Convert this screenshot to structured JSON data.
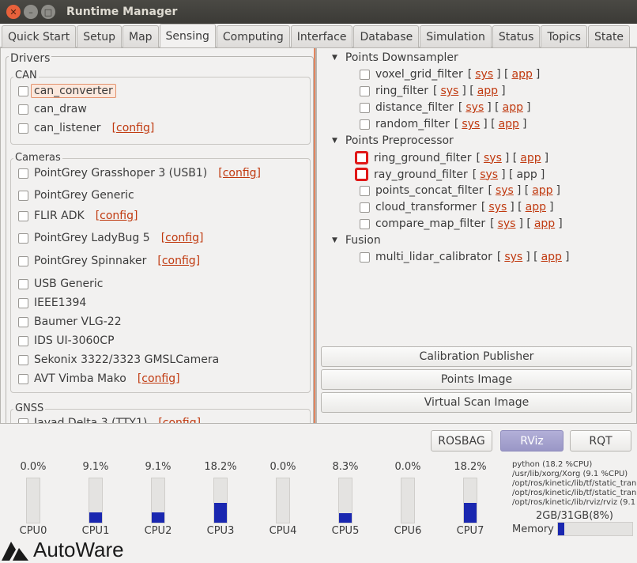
{
  "window": {
    "title": "Runtime Manager"
  },
  "tabs": [
    "Quick Start",
    "Setup",
    "Map",
    "Sensing",
    "Computing",
    "Interface",
    "Database",
    "Simulation",
    "Status",
    "Topics",
    "State"
  ],
  "active_tab": "Sensing",
  "drivers": {
    "label": "Drivers",
    "can": {
      "label": "CAN",
      "items": [
        {
          "name": "can_converter"
        },
        {
          "name": "can_draw"
        },
        {
          "name": "can_listener",
          "link": "[config]"
        }
      ]
    },
    "cameras": {
      "label": "Cameras",
      "items": [
        {
          "name": "PointGrey Grasshoper 3 (USB1)",
          "link": "[config]"
        },
        {
          "name": "PointGrey Generic"
        },
        {
          "name": "FLIR ADK",
          "link": "[config]"
        },
        {
          "name": "PointGrey LadyBug 5",
          "link": "[config]"
        },
        {
          "name": "PointGrey Spinnaker",
          "link": "[config]"
        },
        {
          "name": "USB Generic"
        },
        {
          "name": "IEEE1394"
        },
        {
          "name": "Baumer VLG-22"
        },
        {
          "name": "IDS UI-3060CP"
        },
        {
          "name": "Sekonix 3322/3323 GMSLCamera"
        },
        {
          "name": "AVT Vimba Mako",
          "link": "[config]"
        }
      ]
    },
    "gnss": {
      "label": "GNSS",
      "items": [
        {
          "name": "Javad Delta 3 (TTY1)",
          "link": "[config]"
        }
      ]
    }
  },
  "tree": {
    "groups": [
      {
        "label": "Points Downsampler",
        "items": [
          "voxel_grid_filter",
          "ring_filter",
          "distance_filter",
          "random_filter"
        ]
      },
      {
        "label": "Points Preprocessor",
        "items": [
          "ring_ground_filter",
          "ray_ground_filter",
          "points_concat_filter",
          "cloud_transformer",
          "compare_map_filter"
        ]
      },
      {
        "label": "Fusion",
        "items": [
          "multi_lidar_calibrator"
        ]
      }
    ],
    "sys": "sys",
    "app": "app"
  },
  "buttons": {
    "calibration": "Calibration Publisher",
    "points_image": "Points Image",
    "virtual_scan": "Virtual Scan Image",
    "rosbag": "ROSBAG",
    "rviz": "RViz",
    "rqt": "RQT"
  },
  "cpus": [
    {
      "label": "CPU0",
      "value": "0.0%",
      "pct": 0.0
    },
    {
      "label": "CPU1",
      "value": "9.1%",
      "pct": 9.1
    },
    {
      "label": "CPU2",
      "value": "9.1%",
      "pct": 9.1
    },
    {
      "label": "CPU3",
      "value": "18.2%",
      "pct": 18.2
    },
    {
      "label": "CPU4",
      "value": "0.0%",
      "pct": 0.0
    },
    {
      "label": "CPU5",
      "value": "8.3%",
      "pct": 8.3
    },
    {
      "label": "CPU6",
      "value": "0.0%",
      "pct": 0.0
    },
    {
      "label": "CPU7",
      "value": "18.2%",
      "pct": 18.2
    }
  ],
  "processes": [
    "python (18.2 %CPU)",
    "/usr/lib/xorg/Xorg (9.1 %CPU)",
    "/opt/ros/kinetic/lib/tf/static_tran",
    "/opt/ros/kinetic/lib/tf/static_tran",
    "/opt/ros/kinetic/lib/rviz/rviz (9.1"
  ],
  "memory": {
    "label": "Memory",
    "value": "2GB/31GB(8%)",
    "pct": 8
  },
  "logo": "AutoWare",
  "colors": {
    "accent": "#c03a10",
    "bar": "#1a27b0",
    "highlight": "#e01818"
  }
}
